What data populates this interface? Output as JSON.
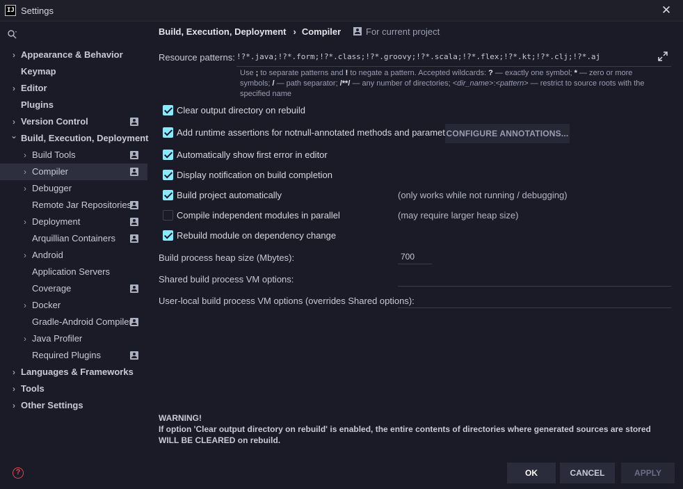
{
  "window": {
    "title": "Settings",
    "logo_text": "IJ"
  },
  "sidebar": {
    "items": [
      {
        "label": "Appearance & Behavior",
        "level": 0,
        "chevron": true,
        "bold": true,
        "project": false,
        "selected": false
      },
      {
        "label": "Keymap",
        "level": 0,
        "chevron": false,
        "bold": true,
        "project": false,
        "selected": false
      },
      {
        "label": "Editor",
        "level": 0,
        "chevron": true,
        "bold": true,
        "project": false,
        "selected": false
      },
      {
        "label": "Plugins",
        "level": 0,
        "chevron": false,
        "bold": true,
        "project": false,
        "selected": false
      },
      {
        "label": "Version Control",
        "level": 0,
        "chevron": true,
        "bold": true,
        "project": true,
        "selected": false
      },
      {
        "label": "Build, Execution, Deployment",
        "level": 0,
        "chevron": "down",
        "bold": true,
        "project": false,
        "selected": false
      },
      {
        "label": "Build Tools",
        "level": 1,
        "chevron": true,
        "bold": false,
        "project": true,
        "selected": false
      },
      {
        "label": "Compiler",
        "level": 1,
        "chevron": true,
        "bold": false,
        "project": true,
        "selected": true
      },
      {
        "label": "Debugger",
        "level": 1,
        "chevron": true,
        "bold": false,
        "project": false,
        "selected": false
      },
      {
        "label": "Remote Jar Repositories",
        "level": 1,
        "chevron": false,
        "bold": false,
        "project": true,
        "selected": false
      },
      {
        "label": "Deployment",
        "level": 1,
        "chevron": true,
        "bold": false,
        "project": true,
        "selected": false
      },
      {
        "label": "Arquillian Containers",
        "level": 1,
        "chevron": false,
        "bold": false,
        "project": true,
        "selected": false
      },
      {
        "label": "Android",
        "level": 1,
        "chevron": true,
        "bold": false,
        "project": false,
        "selected": false
      },
      {
        "label": "Application Servers",
        "level": 1,
        "chevron": false,
        "bold": false,
        "project": false,
        "selected": false
      },
      {
        "label": "Coverage",
        "level": 1,
        "chevron": false,
        "bold": false,
        "project": true,
        "selected": false
      },
      {
        "label": "Docker",
        "level": 1,
        "chevron": true,
        "bold": false,
        "project": false,
        "selected": false
      },
      {
        "label": "Gradle-Android Compiler",
        "level": 1,
        "chevron": false,
        "bold": false,
        "project": true,
        "selected": false
      },
      {
        "label": "Java Profiler",
        "level": 1,
        "chevron": true,
        "bold": false,
        "project": false,
        "selected": false
      },
      {
        "label": "Required Plugins",
        "level": 1,
        "chevron": false,
        "bold": false,
        "project": true,
        "selected": false
      },
      {
        "label": "Languages & Frameworks",
        "level": 0,
        "chevron": true,
        "bold": true,
        "project": false,
        "selected": false
      },
      {
        "label": "Tools",
        "level": 0,
        "chevron": true,
        "bold": true,
        "project": false,
        "selected": false
      },
      {
        "label": "Other Settings",
        "level": 0,
        "chevron": true,
        "bold": true,
        "project": false,
        "selected": false
      }
    ]
  },
  "breadcrumb": {
    "parent": "Build, Execution, Deployment",
    "current": "Compiler",
    "separator": "›"
  },
  "scope": {
    "label": "For current project"
  },
  "resource_patterns": {
    "label": "Resource patterns:",
    "value": "!?*.java;!?*.form;!?*.class;!?*.groovy;!?*.scala;!?*.flex;!?*.kt;!?*.clj;!?*.aj"
  },
  "hint": {
    "p1": "Use ",
    "k1": ";",
    "p2": " to separate patterns and ",
    "k2": "!",
    "p3": " to negate a pattern. Accepted wildcards: ",
    "k3": "?",
    "p4": " — exactly one symbol; ",
    "k4": "*",
    "p5": " — zero or more symbols; ",
    "k5": "/",
    "p6": " — path separator; ",
    "k6": "/**/",
    "p7": " — any number of directories; ",
    "i1": "<dir_name>",
    "p8": ":",
    "i2": "<pattern>",
    "p9": " — restrict to source roots with the specified name"
  },
  "options": {
    "clear_output": {
      "label": "Clear output directory on rebuild",
      "checked": true
    },
    "runtime_assertions": {
      "label": "Add runtime assertions for notnull-annotated methods and parameters",
      "checked": true
    },
    "configure_annotations": "CONFIGURE ANNOTATIONS...",
    "show_first_error": {
      "label": "Automatically show first error in editor",
      "checked": true
    },
    "notify_completion": {
      "label": "Display notification on build completion",
      "checked": true
    },
    "build_automatically": {
      "label": "Build project automatically",
      "checked": true,
      "note": "(only works while not running / debugging)"
    },
    "parallel": {
      "label": "Compile independent modules in parallel",
      "checked": false,
      "note": "(may require larger heap size)"
    },
    "rebuild_on_dependency": {
      "label": "Rebuild module on dependency change",
      "checked": true
    }
  },
  "heap": {
    "label": "Build process heap size (Mbytes):",
    "value": "700"
  },
  "shared_vm": {
    "label": "Shared build process VM options:",
    "value": ""
  },
  "user_vm": {
    "label": "User-local build process VM options (overrides Shared options):",
    "value": ""
  },
  "warning": {
    "title": "WARNING!",
    "text": "If option 'Clear output directory on rebuild' is enabled, the entire contents of directories where generated sources are stored WILL BE CLEARED on rebuild."
  },
  "footer": {
    "ok": "OK",
    "cancel": "CANCEL",
    "apply": "APPLY"
  },
  "colors": {
    "background": "#1a1b26",
    "checkbox": "#8be9fd",
    "selected_row": "#2d2f3f",
    "help": "#e0484f"
  }
}
